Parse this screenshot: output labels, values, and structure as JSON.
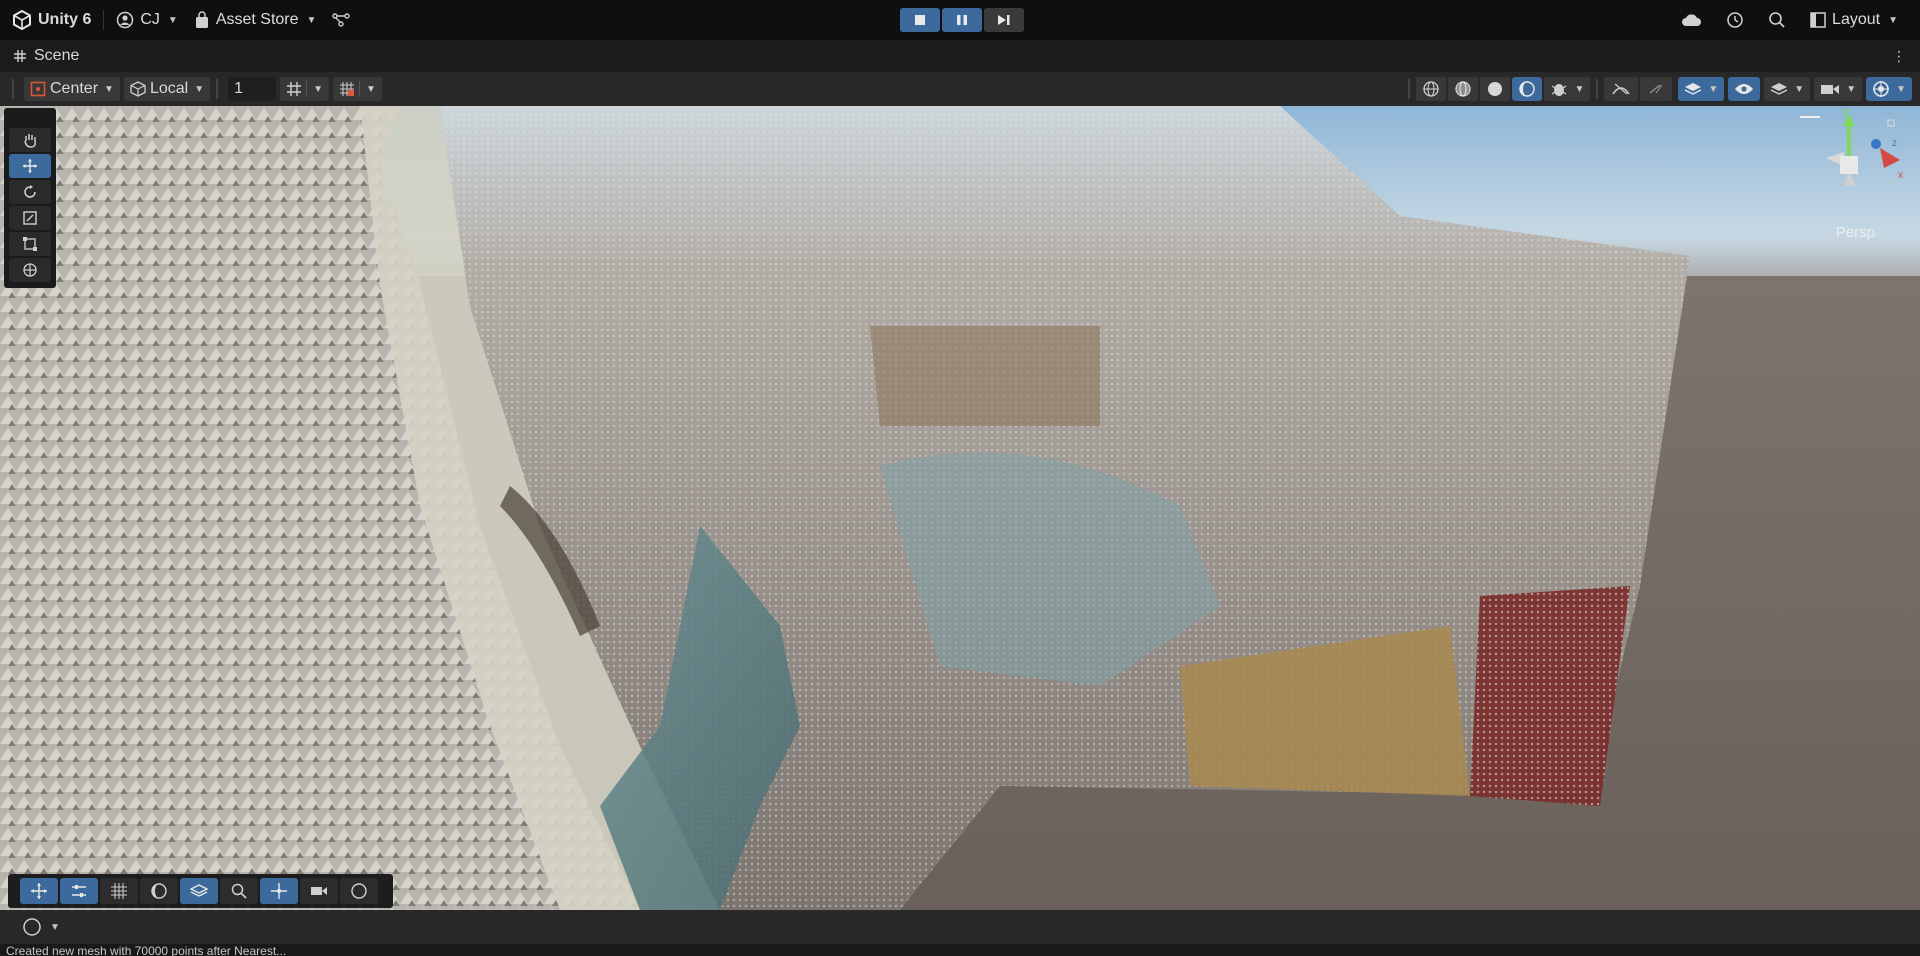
{
  "topbar": {
    "app_title": "Unity 6",
    "account": "CJ",
    "asset_store": "Asset Store",
    "layout": "Layout"
  },
  "scene_tab": {
    "label": "Scene"
  },
  "scene_toolbar": {
    "pivot_mode": "Center",
    "pivot_rotation": "Local",
    "grid_value": "1"
  },
  "viewport": {
    "projection_label": "Persp"
  },
  "status": {
    "message": "Created new mesh with 70000 points after Nearest..."
  },
  "colors": {
    "accent": "#3d6a9c",
    "panel": "#282828",
    "topbar": "#0f0f0f"
  }
}
